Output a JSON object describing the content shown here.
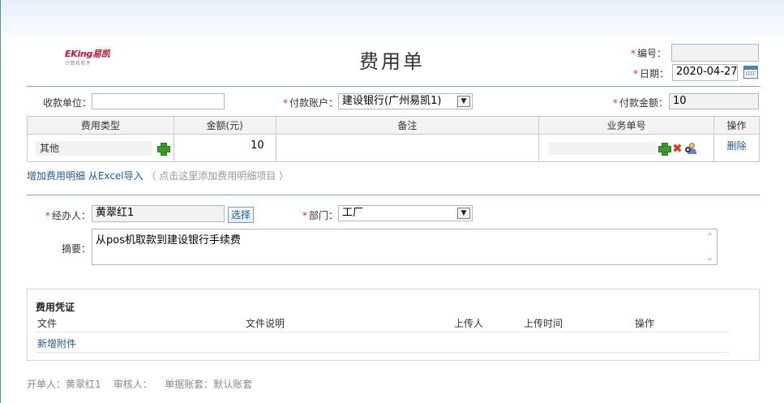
{
  "header": {
    "logo_brand": "EKing易凯",
    "logo_tagline": "计算机软件",
    "title": "费用单",
    "number_label": "编号：",
    "number_value": "",
    "date_label": "日期：",
    "date_value": "2020-04-27"
  },
  "top_fields": {
    "payee_label": "收款单位：",
    "payee_value": "",
    "account_label": "付款账户：",
    "account_value": "建设银行(广州易凯1)",
    "amount_label": "付款金额：",
    "amount_value": "10"
  },
  "expense_table": {
    "headers": [
      "费用类型",
      "金额(元)",
      "备注",
      "业务单号",
      "操作"
    ],
    "rows": [
      {
        "type": "其他",
        "amount": "10",
        "remark": "",
        "business_no": "",
        "action": "删除"
      }
    ]
  },
  "table_links": {
    "add_detail": "增加费用明细",
    "import_excel": "从Excel导入",
    "hint": "（ 点击这里添加费用明细项目 ）"
  },
  "handler": {
    "handler_label": "经办人：",
    "handler_value": "黄翠红1",
    "select_button": "选择",
    "dept_label": "部门：",
    "dept_value": "工厂",
    "summary_label": "摘要：",
    "summary_value": "从pos机取款到建设银行手续费"
  },
  "voucher": {
    "title": "费用凭证",
    "headers": [
      "文件",
      "文件说明",
      "上传人",
      "上传时间",
      "操作"
    ],
    "add_attachment": "新增附件"
  },
  "footer": {
    "creator": "开单人：黄翠红1",
    "reviewer": "审核人：",
    "ledger": "单据账套：默认账套"
  },
  "colors": {
    "accent": "#1a5b9e",
    "required": "#e03030",
    "divider": "#7aa7c7"
  }
}
